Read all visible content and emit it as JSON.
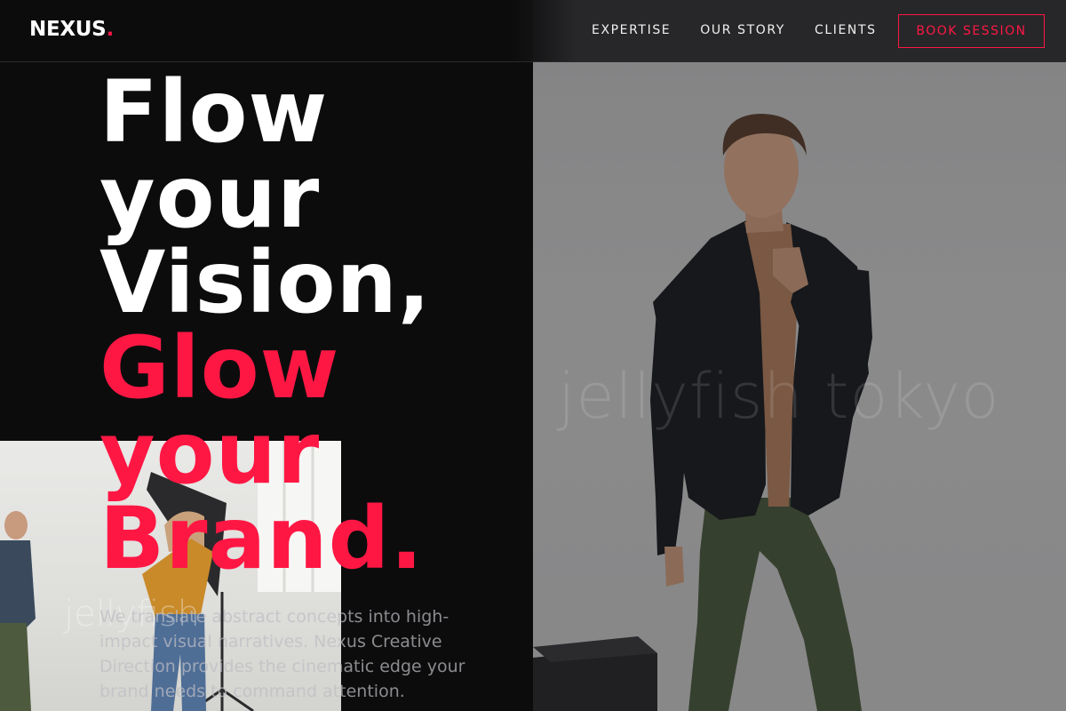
{
  "brand": {
    "name": "NEXUS",
    "dot": "."
  },
  "nav": {
    "links": [
      "EXPERTISE",
      "OUR STORY",
      "CLIENTS"
    ],
    "cta": "BOOK SESSION"
  },
  "hero": {
    "lines_white": [
      "Flow",
      "your",
      "Vision,"
    ],
    "lines_red": [
      "Glow",
      "your",
      "Brand."
    ],
    "description": "We translate abstract concepts into high-impact visual narratives. Nexus Creative Direction provides the cinematic edge your brand needs to command attention.",
    "watermark": "jellyfish tokyo",
    "watermark_small": "jellyfish"
  },
  "colors": {
    "accent": "#ff1744",
    "background": "#0c0c0d",
    "nav": "#222224"
  }
}
